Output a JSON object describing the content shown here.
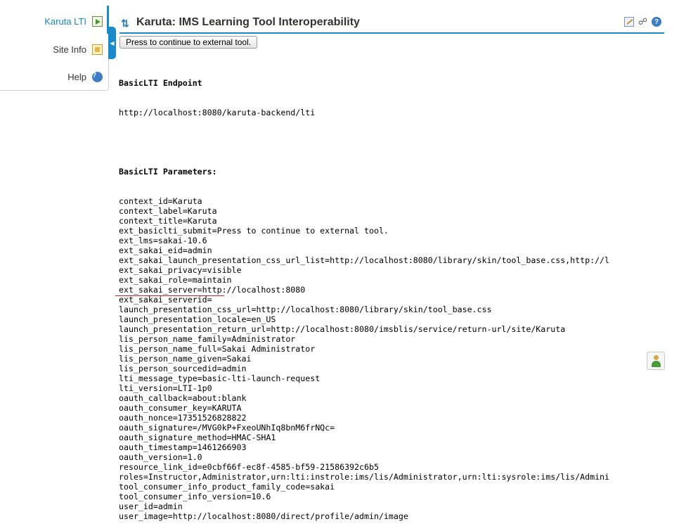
{
  "sidebar": {
    "items": [
      {
        "label": "Karuta LTI",
        "icon": "launch-icon",
        "active": true
      },
      {
        "label": "Site Info",
        "icon": "site-info-icon",
        "active": false
      },
      {
        "label": "Help",
        "icon": "help-icon",
        "active": false
      }
    ]
  },
  "header": {
    "title": "Karuta: IMS Learning Tool Interoperability"
  },
  "launch_button": "Press to continue to external tool.",
  "endpoint": {
    "heading": "BasicLTI Endpoint",
    "url": "http://localhost:8080/karuta-backend/lti"
  },
  "parameters": {
    "heading": "BasicLTI Parameters:",
    "lines": [
      "context_id=Karuta",
      "context_label=Karuta",
      "context_title=Karuta",
      "ext_basiclti_submit=Press to continue to external tool.",
      "ext_lms=sakai-10.6",
      "ext_sakai_eid=admin",
      "ext_sakai_launch_presentation_css_url_list=http://localhost:8080/library/skin/tool_base.css,http://l",
      "ext_sakai_privacy=visible",
      "ext_sakai_role=maintain",
      "ext_sakai_server=http://localhost:8080",
      "ext_sakai_serverid=",
      "launch_presentation_css_url=http://localhost:8080/library/skin/tool_base.css",
      "launch_presentation_locale=en_US",
      "launch_presentation_return_url=http://localhost:8080/imsblis/service/return-url/site/Karuta",
      "lis_person_name_family=Administrator",
      "lis_person_name_full=Sakai Administrator",
      "lis_person_name_given=Sakai",
      "lis_person_sourcedid=admin",
      "lti_message_type=basic-lti-launch-request",
      "lti_version=LTI-1p0",
      "oauth_callback=about:blank",
      "oauth_consumer_key=KARUTA",
      "oauth_nonce=17351526828822",
      "oauth_signature=/MVG0kP+FxeoUNhIq8bnM6frNQc=",
      "oauth_signature_method=HMAC-SHA1",
      "oauth_timestamp=1461266903",
      "oauth_version=1.0",
      "resource_link_id=e0cbf66f-ec8f-4585-bf59-21586392c6b5",
      "roles=Instructor,Administrator,urn:lti:instrole:ims/lis/Administrator,urn:lti:sysrole:ims/lis/Admini",
      "tool_consumer_info_product_family_code=sakai",
      "tool_consumer_info_version=10.6",
      "user_id=admin",
      "user_image=http://localhost:8080/direct/profile/admin/image"
    ]
  },
  "colors": {
    "accent": "#1a8ac9",
    "highlight_underline": "#cc2222"
  }
}
